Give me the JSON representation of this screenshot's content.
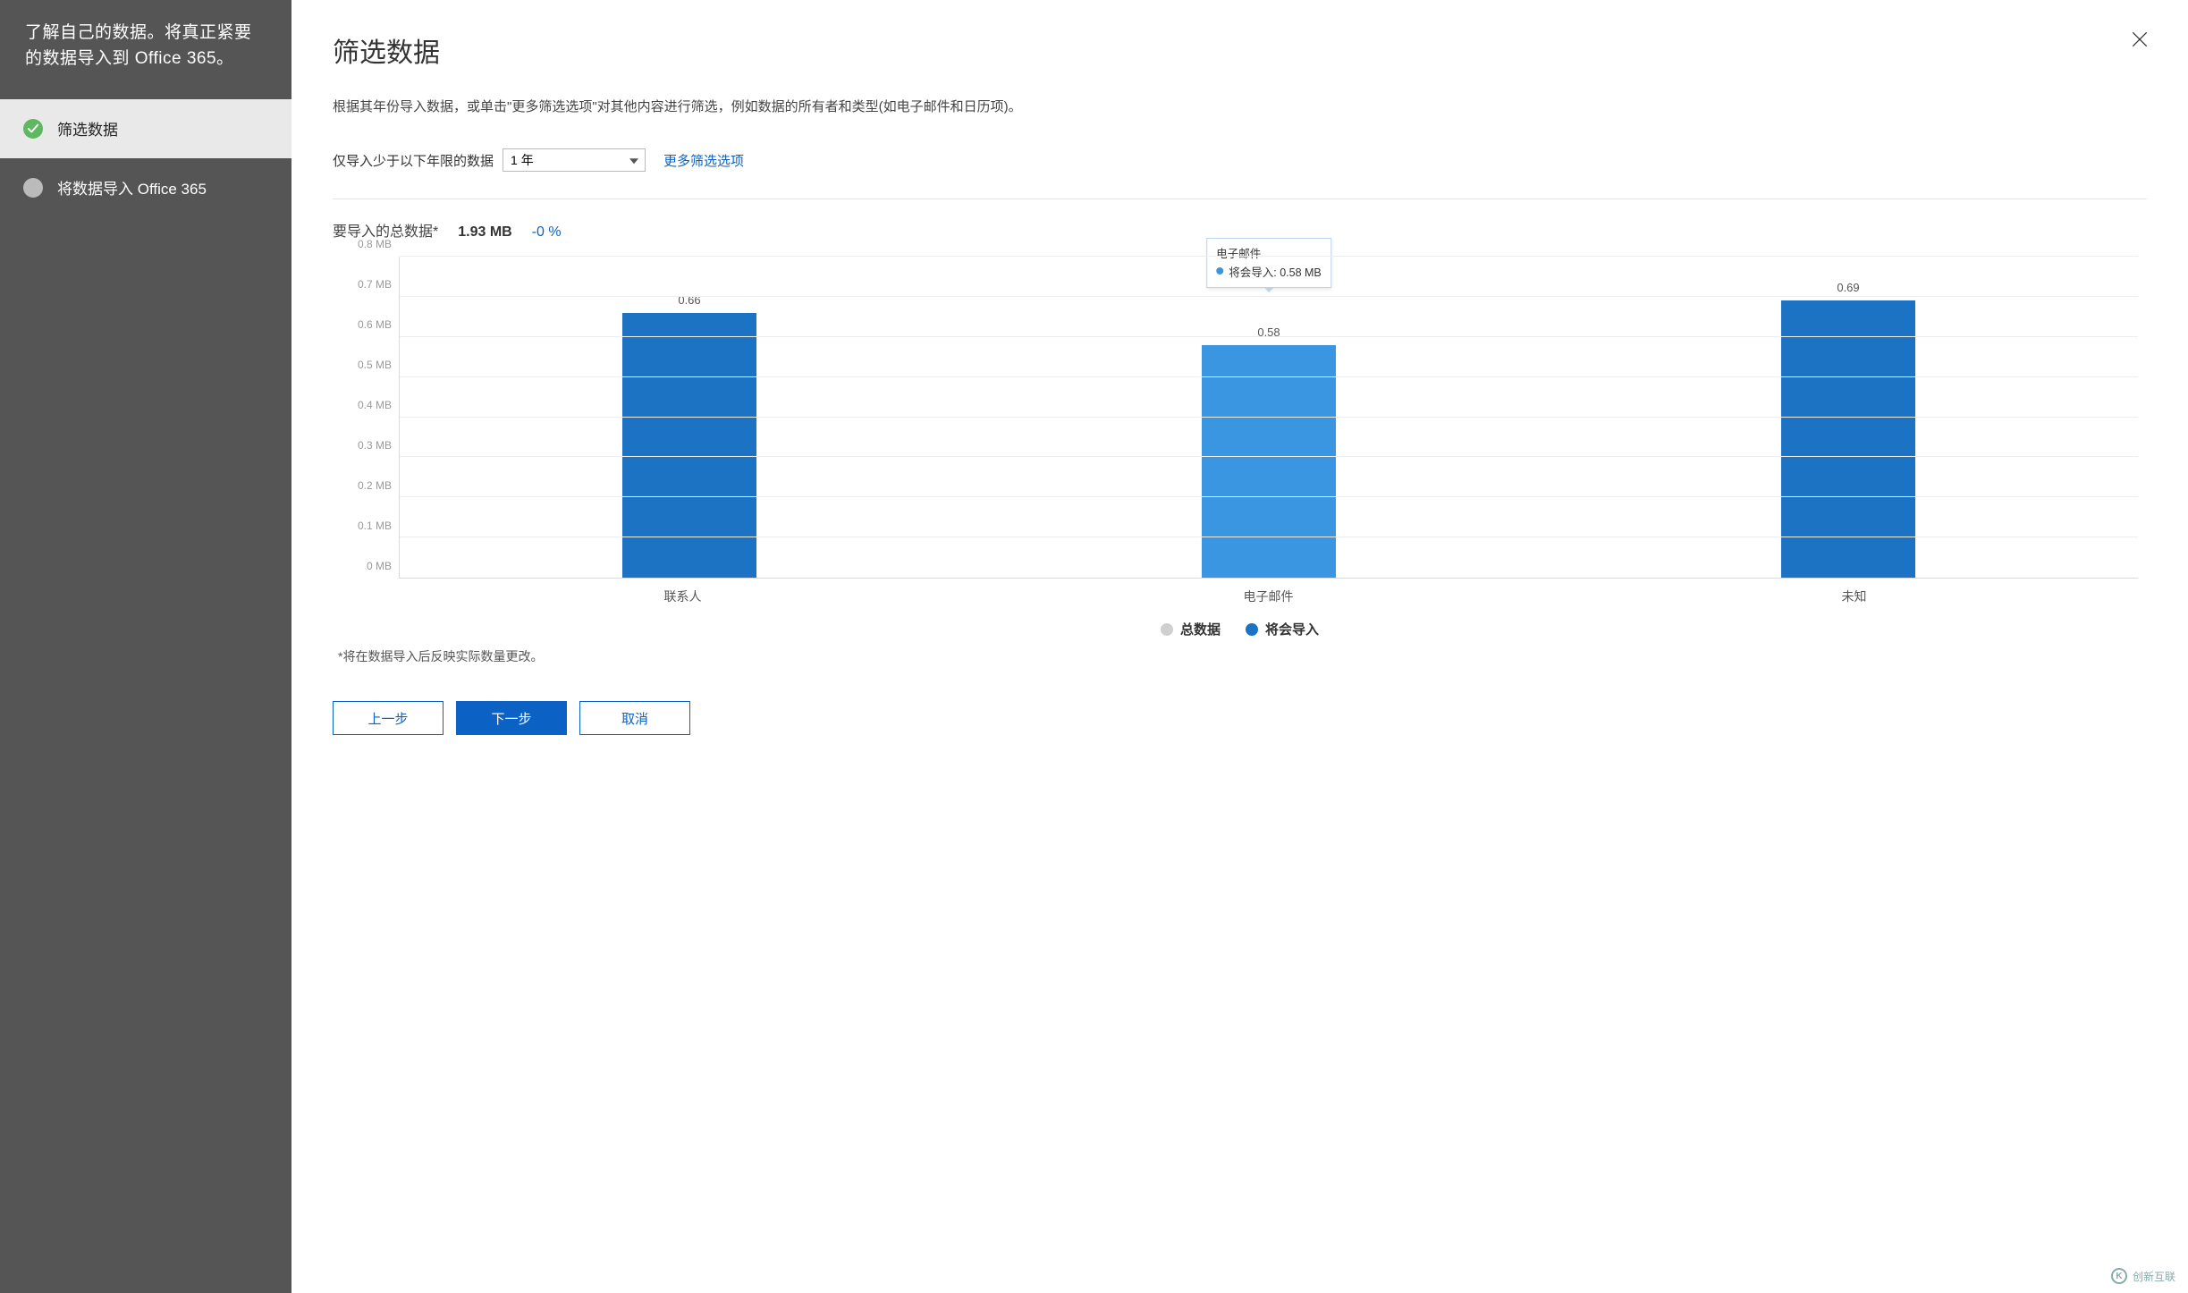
{
  "sidebar": {
    "header": "了解自己的数据。将真正紧要的数据导入到 Office 365。",
    "steps": [
      {
        "label": "筛选数据",
        "active": true,
        "done": true
      },
      {
        "label": "将数据导入 Office 365",
        "active": false,
        "done": false
      }
    ]
  },
  "header": {
    "title": "筛选数据"
  },
  "intro": "根据其年份导入数据，或单击\"更多筛选选项\"对其他内容进行筛选，例如数据的所有者和类型(如电子邮件和日历项)。",
  "filter": {
    "label": "仅导入少于以下年限的数据",
    "selected": "1 年",
    "options": [
      "1 年"
    ],
    "more_link": "更多筛选选项"
  },
  "totals": {
    "label": "要导入的总数据*",
    "value": "1.93 MB",
    "percent": "-0 %"
  },
  "chart_data": {
    "type": "bar",
    "ymax": 0.8,
    "y_unit": "MB",
    "y_ticks": [
      0,
      0.1,
      0.2,
      0.3,
      0.4,
      0.5,
      0.6,
      0.7,
      0.8
    ],
    "y_tick_labels": [
      "0 MB",
      "0.1 MB",
      "0.2 MB",
      "0.3 MB",
      "0.4 MB",
      "0.5 MB",
      "0.6 MB",
      "0.7 MB",
      "0.8 MB"
    ],
    "categories": [
      "联系人",
      "电子邮件",
      "未知"
    ],
    "series_colors": {
      "总数据": "#cfcfcf",
      "将会导入": "#1c73c4"
    },
    "series": [
      {
        "name": "总数据",
        "values": [
          0.66,
          0.58,
          0.69
        ]
      },
      {
        "name": "将会导入",
        "values": [
          0.66,
          0.58,
          0.69
        ]
      }
    ],
    "bar_value_labels": [
      "0.66",
      "0.58",
      "0.69"
    ],
    "bar_colors": [
      "#1c73c4",
      "#3a96e0",
      "#1c73c4"
    ],
    "tooltip": {
      "on_index": 1,
      "category": "电子邮件",
      "series": "将会导入",
      "value_label": "0.58 MB"
    },
    "legend": [
      {
        "label": "总数据",
        "color": "#cfcfcf"
      },
      {
        "label": "将会导入",
        "color": "#1c73c4"
      }
    ]
  },
  "footnote": "*将在数据导入后反映实际数量更改。",
  "buttons": {
    "back": "上一步",
    "next": "下一步",
    "cancel": "取消"
  },
  "watermark": "创新互联"
}
